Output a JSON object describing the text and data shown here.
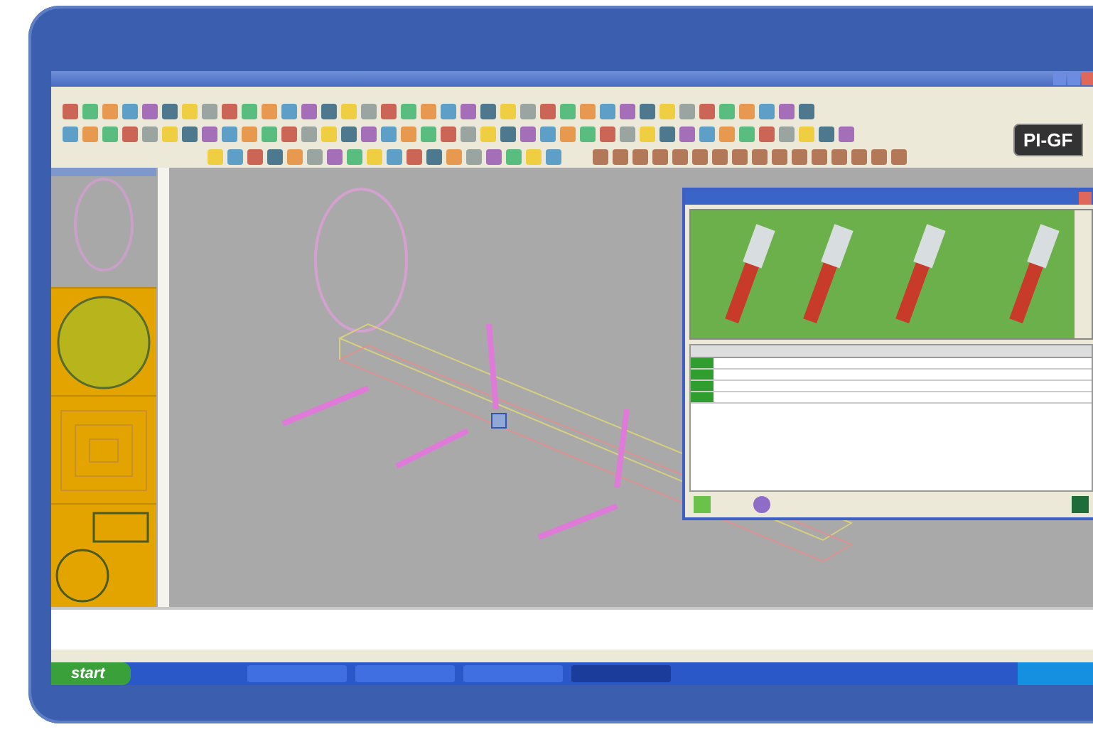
{
  "badge": {
    "label": "PI-GF"
  },
  "taskbar": {
    "start_button": "start",
    "windows": [
      {
        "selected": false
      },
      {
        "selected": false
      },
      {
        "selected": false
      },
      {
        "selected": true
      }
    ]
  }
}
